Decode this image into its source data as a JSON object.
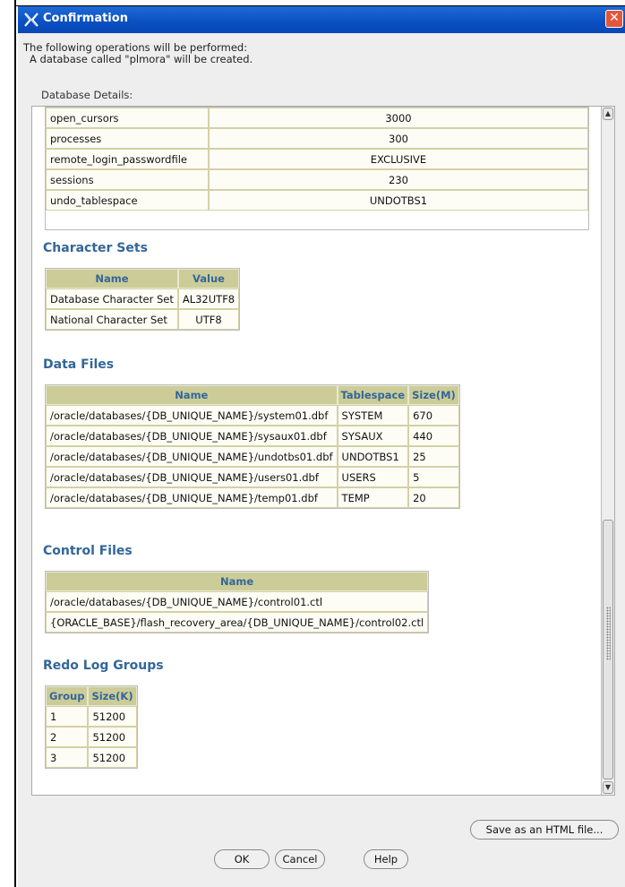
{
  "window": {
    "title": "Confirmation"
  },
  "intro": {
    "line1": "The following operations will be performed:",
    "line2": "A database called \"plmora\" will be created."
  },
  "database_details_label": "Database Details:",
  "params": [
    {
      "name": "open_cursors",
      "value": "3000"
    },
    {
      "name": "processes",
      "value": "300"
    },
    {
      "name": "remote_login_passwordfile",
      "value": "EXCLUSIVE"
    },
    {
      "name": "sessions",
      "value": "230"
    },
    {
      "name": "undo_tablespace",
      "value": "UNDOTBS1"
    }
  ],
  "character_sets": {
    "heading": "Character Sets",
    "headers": [
      "Name",
      "Value"
    ],
    "rows": [
      [
        "Database Character Set",
        "AL32UTF8"
      ],
      [
        "National Character Set",
        "UTF8"
      ]
    ]
  },
  "data_files": {
    "heading": "Data Files",
    "headers": [
      "Name",
      "Tablespace",
      "Size(M)"
    ],
    "rows": [
      [
        "/oracle/databases/{DB_UNIQUE_NAME}/system01.dbf",
        "SYSTEM",
        "670"
      ],
      [
        "/oracle/databases/{DB_UNIQUE_NAME}/sysaux01.dbf",
        "SYSAUX",
        "440"
      ],
      [
        "/oracle/databases/{DB_UNIQUE_NAME}/undotbs01.dbf",
        "UNDOTBS1",
        "25"
      ],
      [
        "/oracle/databases/{DB_UNIQUE_NAME}/users01.dbf",
        "USERS",
        "5"
      ],
      [
        "/oracle/databases/{DB_UNIQUE_NAME}/temp01.dbf",
        "TEMP",
        "20"
      ]
    ]
  },
  "control_files": {
    "heading": "Control Files",
    "headers": [
      "Name"
    ],
    "rows": [
      [
        "/oracle/databases/{DB_UNIQUE_NAME}/control01.ctl"
      ],
      [
        "{ORACLE_BASE}/flash_recovery_area/{DB_UNIQUE_NAME}/control02.ctl"
      ]
    ]
  },
  "redo_log_groups": {
    "heading": "Redo Log Groups",
    "headers": [
      "Group",
      "Size(K)"
    ],
    "rows": [
      [
        "1",
        "51200"
      ],
      [
        "2",
        "51200"
      ],
      [
        "3",
        "51200"
      ]
    ]
  },
  "buttons": {
    "save_html": "Save as an HTML file...",
    "ok": "OK",
    "cancel": "Cancel",
    "help": "Help"
  },
  "colors": {
    "titlebar": "#0a4fc2",
    "table_header_bg": "#cccc99",
    "heading_text": "#336699",
    "close_button": "#e2573b"
  },
  "icons": [
    "app-icon",
    "close-icon",
    "scroll-up-icon",
    "scroll-down-icon"
  ]
}
